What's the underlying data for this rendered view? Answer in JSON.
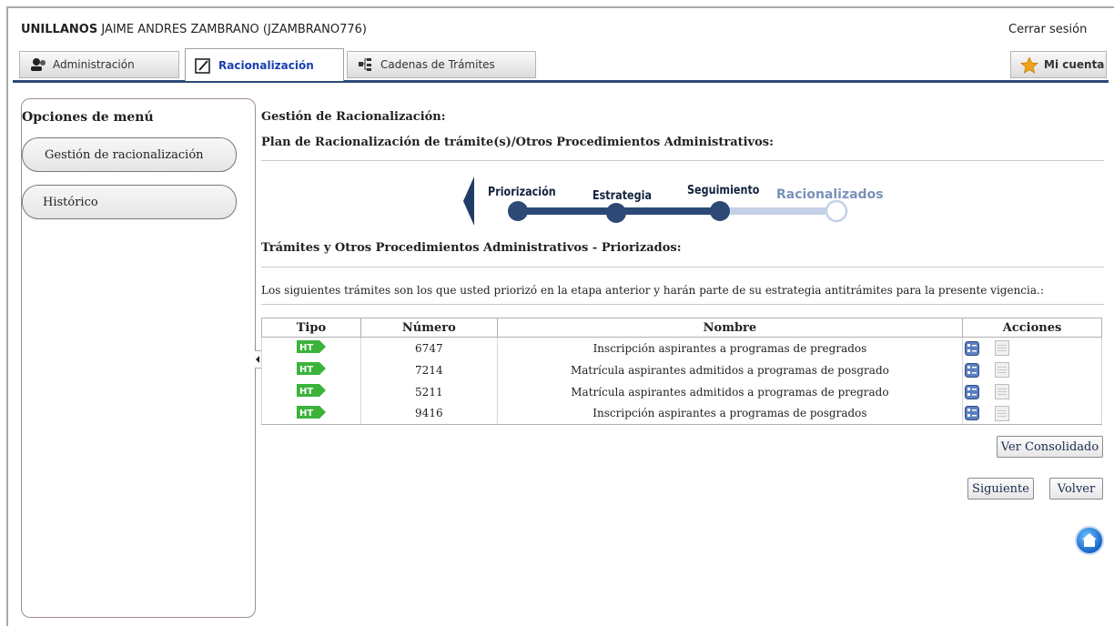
{
  "header": {
    "org": "UNILLANOS",
    "user": "JAIME ANDRES ZAMBRANO (JZAMBRANO776)",
    "logout": "Cerrar sesión"
  },
  "tabs": {
    "admin": "Administración",
    "racionalizacion": "Racionalización",
    "cadenas": "Cadenas de Trámites",
    "cuenta": "Mi cuenta"
  },
  "sidebar": {
    "title": "Opciones de menú",
    "items": [
      {
        "label": "Gestión de racionalización"
      },
      {
        "label": "Histórico"
      }
    ]
  },
  "main": {
    "title": "Gestión de Racionalización:",
    "subtitle": "Plan de Racionalización de trámite(s)/Otros Procedimientos Administrativos:",
    "steps": [
      "Priorización",
      "Estrategia",
      "Seguimiento",
      "Racionalizados"
    ],
    "section_title": "Trámites y Otros Procedimientos Administrativos - Priorizados:",
    "description": "Los siguientes trámites son los que usted priorizó en la etapa anterior y harán parte de su estrategia antitrámites para la presente vigencia.:"
  },
  "table": {
    "headers": [
      "Tipo",
      "Número",
      "Nombre",
      "Acciones"
    ],
    "rows": [
      {
        "tipo": "HT",
        "numero": "6747",
        "nombre": "Inscripción aspirantes a programas de pregrados"
      },
      {
        "tipo": "HT",
        "numero": "7214",
        "nombre": "Matrícula aspirantes admitidos a programas de posgrado"
      },
      {
        "tipo": "HT",
        "numero": "5211",
        "nombre": "Matrícula aspirantes admitidos a programas de pregrado"
      },
      {
        "tipo": "HT",
        "numero": "9416",
        "nombre": "Inscripción aspirantes a programas de posgrados"
      }
    ]
  },
  "buttons": {
    "consolidado": "Ver Consolidado",
    "siguiente": "Siguiente",
    "volver": "Volver"
  },
  "colors": {
    "accent": "#2c4a75",
    "tab_active_text": "#1a3fb0",
    "ht_green": "#3bb33b"
  }
}
